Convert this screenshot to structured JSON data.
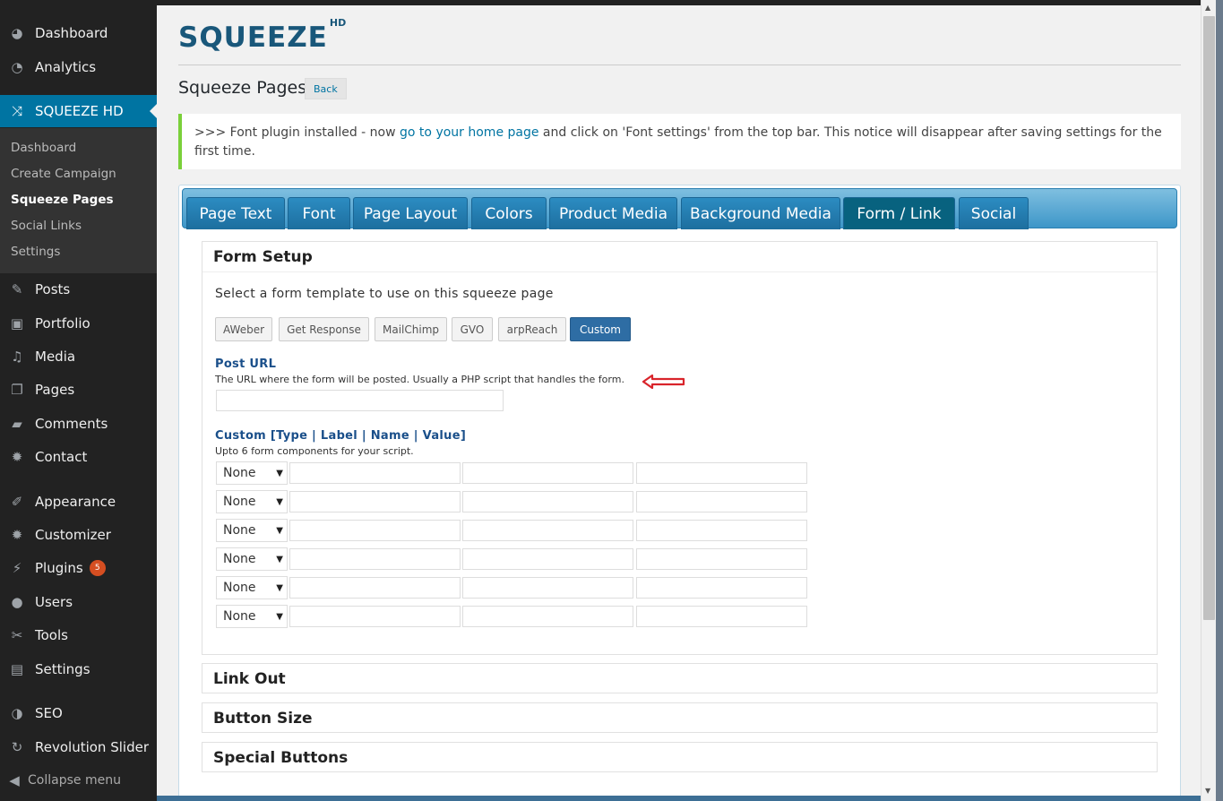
{
  "sidebar": {
    "top_items": [
      {
        "label": "Dashboard",
        "icon": "dashboard-icon"
      },
      {
        "label": "Analytics",
        "icon": "analytics-icon"
      }
    ],
    "active_item": {
      "label": "SQUEEZE HD",
      "icon": "shuffle-icon"
    },
    "submenu": [
      "Dashboard",
      "Create Campaign",
      "Squeeze Pages",
      "Social Links",
      "Settings"
    ],
    "current_submenu": "Squeeze Pages",
    "items": [
      {
        "label": "Posts",
        "icon": "pin-icon"
      },
      {
        "label": "Portfolio",
        "icon": "portfolio-icon"
      },
      {
        "label": "Media",
        "icon": "media-icon"
      },
      {
        "label": "Pages",
        "icon": "pages-icon"
      },
      {
        "label": "Comments",
        "icon": "comments-icon"
      },
      {
        "label": "Contact",
        "icon": "gear-icon"
      },
      {
        "label": "Appearance",
        "icon": "brush-icon"
      },
      {
        "label": "Customizer",
        "icon": "gear-icon"
      },
      {
        "label": "Plugins",
        "icon": "plug-icon",
        "badge": "5"
      },
      {
        "label": "Users",
        "icon": "users-icon"
      },
      {
        "label": "Tools",
        "icon": "wrench-icon"
      },
      {
        "label": "Settings",
        "icon": "settings-icon"
      },
      {
        "label": "SEO",
        "icon": "seo-icon"
      },
      {
        "label": "Revolution Slider",
        "icon": "refresh-icon"
      }
    ],
    "collapse_label": "Collapse menu"
  },
  "header": {
    "logo_text": "SQUEEZE",
    "logo_sup": "HD",
    "page_title": "Squeeze Pages",
    "back_label": "Back"
  },
  "notice": {
    "prefix": ">>> Font plugin installed - now ",
    "link": "go to your home page",
    "suffix": " and click on 'Font settings' from the top bar. This notice will disappear after saving settings for the first time."
  },
  "tabs": [
    "Page Text",
    "Font",
    "Page Layout",
    "Colors",
    "Product Media",
    "Background Media",
    "Form / Link",
    "Social"
  ],
  "active_tab": "Form / Link",
  "form_setup": {
    "title": "Form Setup",
    "prompt": "Select a form template to use on this squeeze page",
    "templates": [
      "AWeber",
      "Get Response",
      "MailChimp",
      "GVO",
      "arpReach",
      "Custom"
    ],
    "selected_template": "Custom",
    "post_url": {
      "label": "Post URL",
      "description": "The URL where the form will be posted. Usually a PHP script that handles the form.",
      "value": ""
    },
    "custom": {
      "label": "Custom [Type | Label | Name | Value]",
      "description": "Upto 6 form components for your script.",
      "rows": [
        {
          "type": "None",
          "label": "",
          "name": "",
          "value": ""
        },
        {
          "type": "None",
          "label": "",
          "name": "",
          "value": ""
        },
        {
          "type": "None",
          "label": "",
          "name": "",
          "value": ""
        },
        {
          "type": "None",
          "label": "",
          "name": "",
          "value": ""
        },
        {
          "type": "None",
          "label": "",
          "name": "",
          "value": ""
        },
        {
          "type": "None",
          "label": "",
          "name": "",
          "value": ""
        }
      ]
    }
  },
  "sections": [
    "Link Out",
    "Button Size",
    "Special Buttons"
  ],
  "colors": {
    "sidebar": "#222222",
    "active": "#0074a2",
    "notice_border": "#7ad03a",
    "tab": "#1d6e9e",
    "tab_active": "#08627f",
    "arrow": "#d9242b"
  }
}
